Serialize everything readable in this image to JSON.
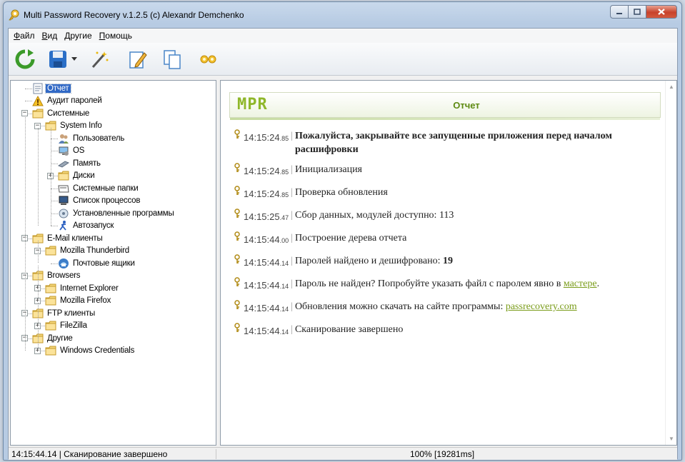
{
  "window": {
    "title": "Multi Password Recovery v.1.2.5 (c) Alexandr Demchenko"
  },
  "menu": [
    {
      "u": "Ф",
      "rest": "айл"
    },
    {
      "u": "В",
      "rest": "ид"
    },
    {
      "u": "",
      "rest": "Другие"
    },
    {
      "u": "П",
      "rest": "омощь"
    }
  ],
  "toolbar": {
    "icons": [
      "refresh-icon",
      "save-icon",
      "dropdown-arrow-icon",
      "wand-icon",
      "edit-icon",
      "copy-icon",
      "settings-icon"
    ]
  },
  "tree": [
    {
      "label": "Отчет",
      "level": 0,
      "icon": "report-icon",
      "selected": true
    },
    {
      "label": "Аудит паролей",
      "level": 0,
      "icon": "warning-icon"
    },
    {
      "label": "Системные",
      "level": 0,
      "icon": "folder-icon",
      "expander": "−"
    },
    {
      "label": "System Info",
      "level": 1,
      "icon": "folder-icon",
      "expander": "−"
    },
    {
      "label": "Пользователь",
      "level": 2,
      "icon": "users-icon"
    },
    {
      "label": "OS",
      "level": 2,
      "icon": "os-icon"
    },
    {
      "label": "Память",
      "level": 2,
      "icon": "memory-icon"
    },
    {
      "label": "Диски",
      "level": 2,
      "icon": "folder-icon",
      "expander": "+"
    },
    {
      "label": "Системные папки",
      "level": 2,
      "icon": "system-folder-icon"
    },
    {
      "label": "Список процессов",
      "level": 2,
      "icon": "process-icon"
    },
    {
      "label": "Установленные программы",
      "level": 2,
      "icon": "programs-icon"
    },
    {
      "label": "Автозапуск",
      "level": 2,
      "icon": "autorun-icon"
    },
    {
      "label": "E-Mail клиенты",
      "level": 0,
      "icon": "folder-icon",
      "expander": "−"
    },
    {
      "label": "Mozilla Thunderbird",
      "level": 1,
      "icon": "folder-icon",
      "expander": "−"
    },
    {
      "label": "Почтовые ящики",
      "level": 2,
      "icon": "mailbox-icon"
    },
    {
      "label": "Browsers",
      "level": 0,
      "icon": "folder-icon",
      "expander": "−"
    },
    {
      "label": "Internet Explorer",
      "level": 1,
      "icon": "folder-icon",
      "expander": "+"
    },
    {
      "label": "Mozilla Firefox",
      "level": 1,
      "icon": "folder-icon",
      "expander": "+"
    },
    {
      "label": "FTP клиенты",
      "level": 0,
      "icon": "folder-icon",
      "expander": "−"
    },
    {
      "label": "FileZilla",
      "level": 1,
      "icon": "folder-icon",
      "expander": "+"
    },
    {
      "label": "Другие",
      "level": 0,
      "icon": "folder-icon",
      "expander": "−"
    },
    {
      "label": "Windows Credentials",
      "level": 1,
      "icon": "folder-icon",
      "expander": "+"
    }
  ],
  "report": {
    "logo": "MPR",
    "title": "Отчет",
    "log": [
      {
        "time": "14:15:24",
        "ms": ".85",
        "parts": [
          {
            "b": "Пожалуйста, закрывайте все запущенные приложения перед началом расшифровки"
          }
        ]
      },
      {
        "time": "14:15:24",
        "ms": ".85",
        "parts": [
          {
            "t": "Инициализация"
          }
        ]
      },
      {
        "time": "14:15:24",
        "ms": ".85",
        "parts": [
          {
            "t": "Проверка обновления"
          }
        ]
      },
      {
        "time": "14:15:25",
        "ms": ".47",
        "parts": [
          {
            "t": "Сбор данных, модулей доступно: 113"
          }
        ]
      },
      {
        "time": "14:15:44",
        "ms": ".00",
        "parts": [
          {
            "t": "Построение дерева отчета"
          }
        ]
      },
      {
        "time": "14:15:44",
        "ms": ".14",
        "parts": [
          {
            "t": "Паролей найдено и дешифровано: "
          },
          {
            "b": "19"
          }
        ]
      },
      {
        "time": "14:15:44",
        "ms": ".14",
        "parts": [
          {
            "t": "Пароль не найден? Попробуйте указать файл с паролем явно в "
          },
          {
            "a": "мастере"
          },
          {
            "t": "."
          }
        ]
      },
      {
        "time": "14:15:44",
        "ms": ".14",
        "parts": [
          {
            "t": "Обновления можно скачать на сайте программы: "
          },
          {
            "a": "passrecovery.com"
          }
        ]
      },
      {
        "time": "14:15:44",
        "ms": ".14",
        "parts": [
          {
            "t": "Сканирование завершено"
          }
        ]
      }
    ]
  },
  "status": {
    "left": "14:15:44.14 | Сканирование завершено",
    "middle": "100% [19281ms]"
  }
}
